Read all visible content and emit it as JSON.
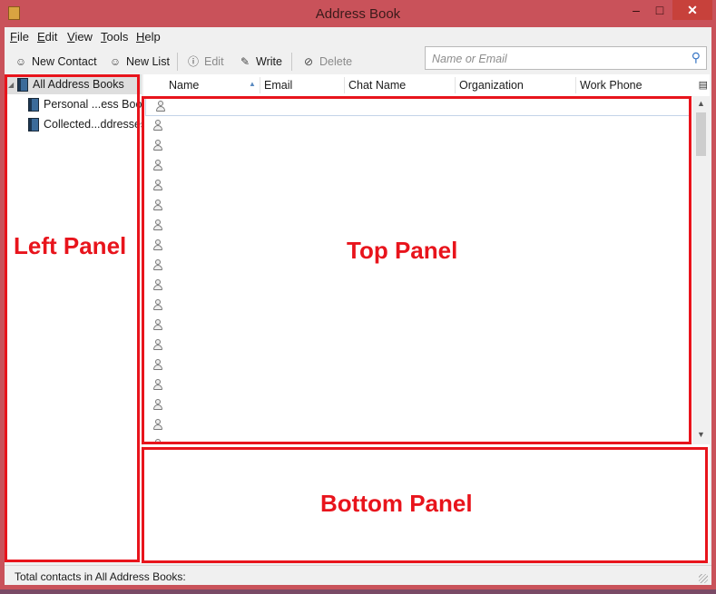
{
  "window": {
    "title": "Address Book",
    "min_glyph": "–",
    "max_glyph": "□",
    "close_glyph": "✕"
  },
  "menu": {
    "file": {
      "u": "F",
      "rest": "ile"
    },
    "edit": {
      "u": "E",
      "rest": "dit"
    },
    "view": {
      "u": "V",
      "rest": "iew"
    },
    "tools": {
      "u": "T",
      "rest": "ools"
    },
    "help": {
      "u": "H",
      "rest": "elp"
    }
  },
  "toolbar": {
    "new_contact": "New Contact",
    "new_list": "New List",
    "edit": "Edit",
    "write": "Write",
    "delete": "Delete",
    "search_placeholder": "Name or Email"
  },
  "address_books": {
    "all": "All Address Books",
    "items": [
      "Personal ...ess Book",
      "Collected...ddresses"
    ]
  },
  "columns": {
    "name": "Name",
    "email": "Email",
    "chat": "Chat Name",
    "org": "Organization",
    "work_phone": "Work Phone"
  },
  "status": {
    "total": "Total contacts in All Address Books:"
  },
  "annotations": {
    "left": "Left Panel",
    "top": "Top Panel",
    "bottom": "Bottom Panel",
    "color": "#e8141c"
  },
  "icons": {
    "search": "search-icon",
    "person": "person-icon",
    "book": "book-icon"
  }
}
